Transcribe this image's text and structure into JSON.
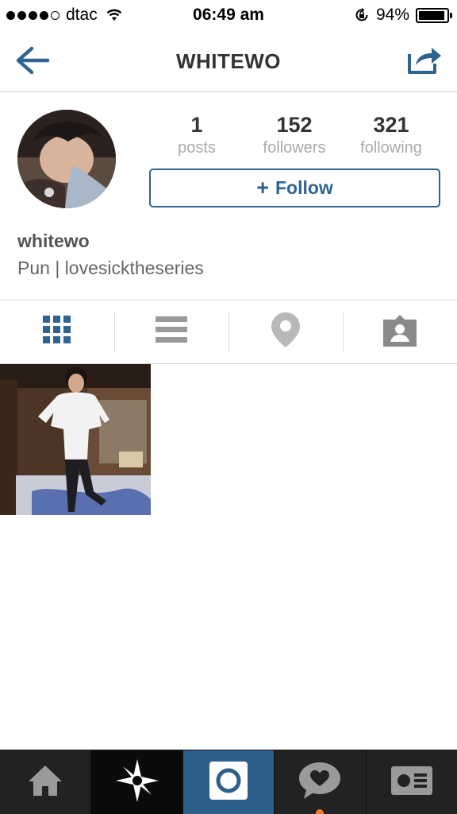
{
  "status_bar": {
    "carrier": "dtac",
    "time": "06:49 am",
    "battery": "94%",
    "battery_level": 0.94,
    "signal_bars_filled": 4,
    "signal_bars_total": 5
  },
  "nav": {
    "title": "WHITEWO",
    "back_icon": "back-arrow-icon",
    "share_icon": "share-icon",
    "accent_color": "#2d6492"
  },
  "profile": {
    "posts_count": "1",
    "posts_label": "posts",
    "followers_count": "152",
    "followers_label": "followers",
    "following_count": "321",
    "following_label": "following",
    "follow_button_label": "Follow",
    "username": "whitewo",
    "bio": "Pun | lovesicktheseries"
  },
  "view_tabs": [
    {
      "icon": "grid-icon",
      "active": true
    },
    {
      "icon": "list-icon",
      "active": false
    },
    {
      "icon": "location-pin-icon",
      "active": false
    },
    {
      "icon": "tagged-photos-icon",
      "active": false
    }
  ],
  "bottom_tabs": [
    {
      "icon": "home-icon"
    },
    {
      "icon": "explore-icon"
    },
    {
      "icon": "camera-icon"
    },
    {
      "icon": "activity-heart-icon",
      "has_notification": true
    },
    {
      "icon": "profile-card-icon"
    }
  ]
}
